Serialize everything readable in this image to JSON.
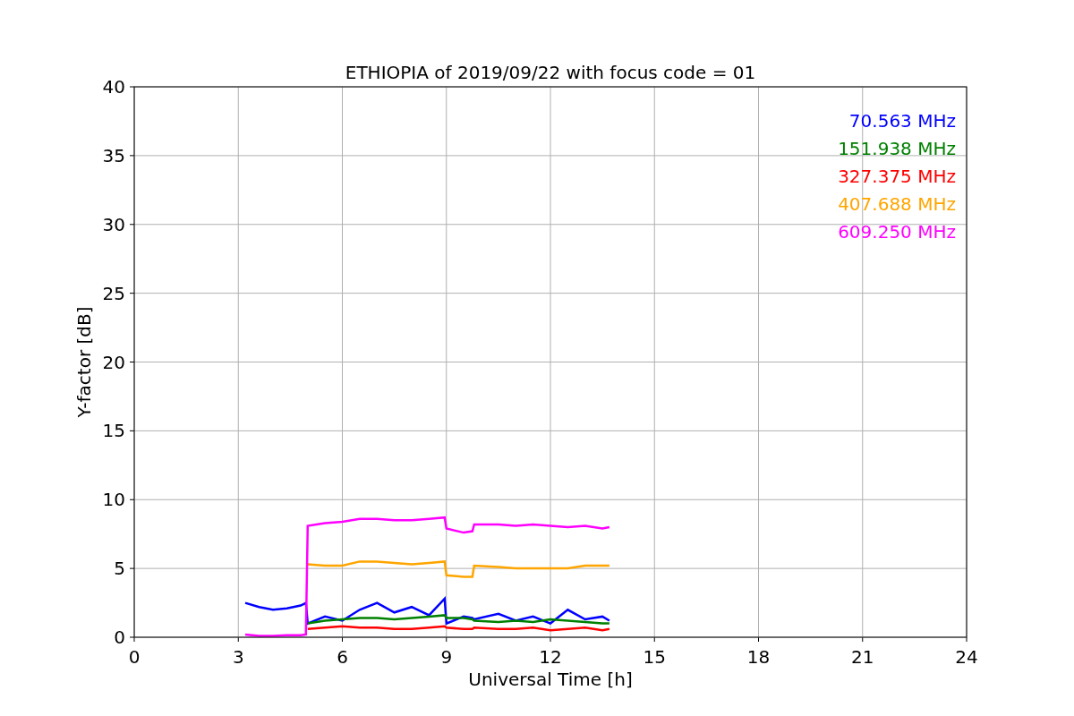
{
  "chart_data": {
    "type": "line",
    "title": "ETHIOPIA of 2019/09/22 with focus code = 01",
    "xlabel": "Universal Time [h]",
    "ylabel": "Y-factor [dB]",
    "x": [
      3.2,
      3.6,
      4.0,
      4.4,
      4.8,
      4.95,
      5.0,
      5.5,
      6.0,
      6.5,
      7.0,
      7.5,
      8.0,
      8.5,
      8.95,
      9.0,
      9.5,
      9.75,
      9.8,
      10.5,
      11.0,
      11.5,
      12.0,
      12.5,
      13.0,
      13.5,
      13.7
    ],
    "series": [
      {
        "name": "70.563 MHz",
        "color": "#0000ff",
        "values": [
          2.5,
          2.2,
          2.0,
          2.1,
          2.3,
          2.5,
          1.0,
          1.5,
          1.2,
          2.0,
          2.5,
          1.8,
          2.2,
          1.6,
          2.8,
          1.0,
          1.5,
          1.4,
          1.3,
          1.7,
          1.2,
          1.5,
          1.0,
          2.0,
          1.3,
          1.5,
          1.2
        ]
      },
      {
        "name": "151.938 MHz",
        "color": "#008000",
        "values": [
          null,
          null,
          null,
          null,
          null,
          null,
          1.0,
          1.2,
          1.3,
          1.4,
          1.4,
          1.3,
          1.4,
          1.5,
          1.6,
          1.4,
          1.4,
          1.3,
          1.2,
          1.1,
          1.2,
          1.1,
          1.3,
          1.2,
          1.1,
          1.0,
          1.0
        ]
      },
      {
        "name": "327.375 MHz",
        "color": "#ff0000",
        "values": [
          null,
          null,
          null,
          null,
          null,
          null,
          0.6,
          0.7,
          0.8,
          0.7,
          0.7,
          0.6,
          0.6,
          0.7,
          0.8,
          0.7,
          0.6,
          0.6,
          0.7,
          0.6,
          0.6,
          0.7,
          0.5,
          0.6,
          0.7,
          0.5,
          0.6
        ]
      },
      {
        "name": "407.688 MHz",
        "color": "#ffa500",
        "values": [
          null,
          null,
          null,
          null,
          null,
          null,
          5.3,
          5.2,
          5.2,
          5.5,
          5.5,
          5.4,
          5.3,
          5.4,
          5.5,
          4.5,
          4.4,
          4.4,
          5.2,
          5.1,
          5.0,
          5.0,
          5.0,
          5.0,
          5.2,
          5.2,
          5.2
        ]
      },
      {
        "name": "609.250 MHz",
        "color": "#ff00ff",
        "values": [
          0.2,
          0.1,
          0.1,
          0.15,
          0.15,
          0.2,
          8.1,
          8.3,
          8.4,
          8.6,
          8.6,
          8.5,
          8.5,
          8.6,
          8.7,
          7.9,
          7.6,
          7.7,
          8.2,
          8.2,
          8.1,
          8.2,
          8.1,
          8.0,
          8.1,
          7.9,
          8.0
        ]
      }
    ],
    "grid": true,
    "xlim": [
      0,
      24
    ],
    "ylim": [
      0,
      40
    ],
    "xticks": [
      0,
      3,
      6,
      9,
      12,
      15,
      18,
      21,
      24
    ],
    "yticks": [
      0,
      5,
      10,
      15,
      20,
      25,
      30,
      35,
      40
    ]
  }
}
